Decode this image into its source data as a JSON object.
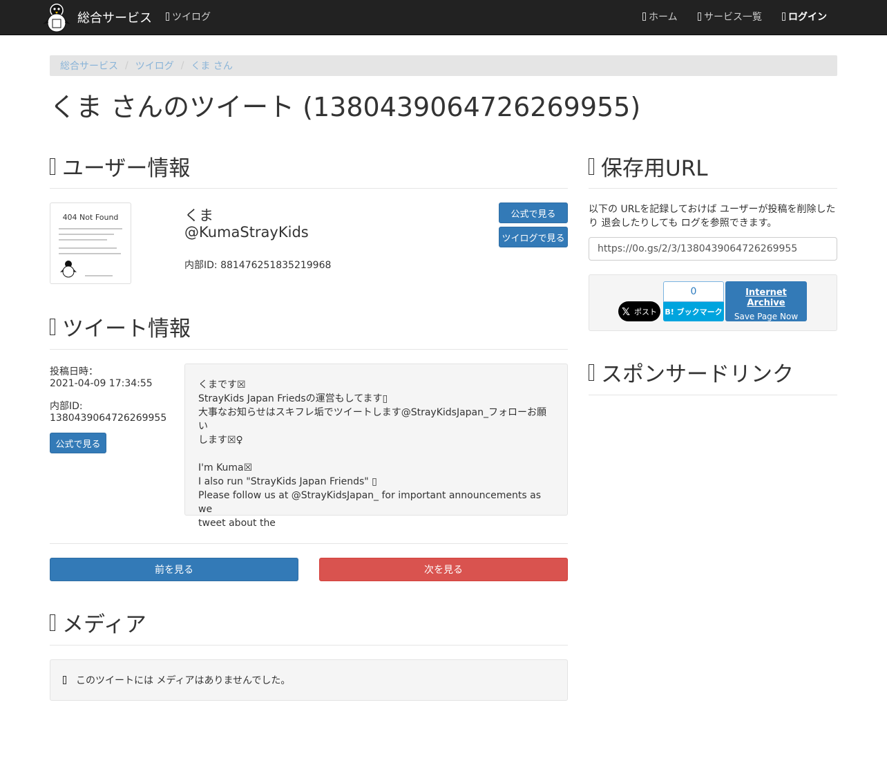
{
  "navbar": {
    "brand": "総合サービス",
    "twilog": "ツイログ",
    "home": "ホーム",
    "services": "サービス一覧",
    "login": "ログイン"
  },
  "breadcrumb": [
    "総合サービス",
    "ツイログ",
    "くま さん"
  ],
  "page_title": "くま さんのツイート (1380439064726269955)",
  "user_section": {
    "heading": "ユーザー情報",
    "name": "くま",
    "handle": "@KumaStrayKids",
    "internal_id": "内部ID: 881476251835219968",
    "avatar_text": "404 Not Found",
    "btn_official": "公式で見る",
    "btn_twilog": "ツイログで見る"
  },
  "tweet_section": {
    "heading": "ツイート情報",
    "posted_label": "投稿日時：",
    "posted_value": "2021-04-09 17:34:55",
    "id_label": "内部ID:",
    "id_value": "1380439064726269955",
    "btn_official": "公式で見る",
    "text_lines": [
      "くまです☒",
      "StrayKids Japan Friedsの運営もしてます▯",
      "大事なお知らせはスキフレ垢でツイートします@StrayKidsJapan_フォローお願い",
      "します☒♀",
      "",
      "I'm Kuma☒",
      "I also run \"StrayKids Japan Friends\" ▯",
      "Please follow us at @StrayKidsJapan_ for important announcements as we",
      "tweet about the"
    ]
  },
  "pager": {
    "prev": "前を見る",
    "next": "次を見る"
  },
  "media_section": {
    "heading": "メディア",
    "empty_text": "このツイートには メディアはありませんでした。"
  },
  "save_section": {
    "heading": "保存用URL",
    "desc": "以下の URLを記録しておけば ユーザーが投稿を削除したり 退会したりしても ログを参照できます。",
    "url": "https://0o.gs/2/3/1380439064726269955",
    "x_label": "ポスト",
    "hatena_count": "0",
    "hatena_label": "B! ブックマーク",
    "ia_title": "Internet Archive",
    "ia_sub": "Save Page Now"
  },
  "sponsor_section": {
    "heading": "スポンサードリンク"
  }
}
